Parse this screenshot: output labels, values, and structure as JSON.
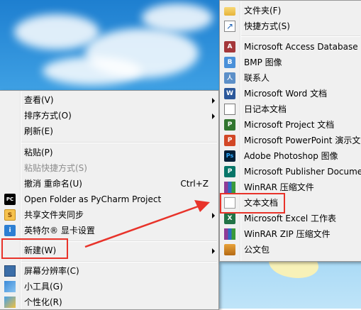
{
  "context_menu": {
    "items": [
      {
        "label": "查看(V)",
        "submenu": true
      },
      {
        "label": "排序方式(O)",
        "submenu": true
      },
      {
        "label": "刷新(E)"
      },
      {
        "label": "粘贴(P)"
      },
      {
        "label": "粘贴快捷方式(S)",
        "disabled": true
      },
      {
        "label": "撤消 重命名(U)",
        "shortcut": "Ctrl+Z"
      },
      {
        "label": "Open Folder as PyCharm Project",
        "icon": "pycharm-icon"
      },
      {
        "label": "共享文件夹同步",
        "icon": "shared-folder-icon",
        "submenu": true
      },
      {
        "label": "英特尔® 显卡设置",
        "icon": "intel-graphics-icon"
      },
      {
        "label": "新建(W)",
        "submenu": true,
        "highlighted": true
      },
      {
        "label": "屏幕分辨率(C)",
        "icon": "screen-resolution-icon"
      },
      {
        "label": "小工具(G)",
        "icon": "gadgets-icon"
      },
      {
        "label": "个性化(R)",
        "icon": "personalize-icon"
      }
    ]
  },
  "new_submenu": {
    "items": [
      {
        "label": "文件夹(F)",
        "icon": "folder-icon"
      },
      {
        "label": "快捷方式(S)",
        "icon": "shortcut-icon"
      },
      {
        "label": "Microsoft Access Database",
        "icon": "access-icon"
      },
      {
        "label": "BMP 图像",
        "icon": "bmp-icon"
      },
      {
        "label": "联系人",
        "icon": "contact-icon"
      },
      {
        "label": "Microsoft Word 文档",
        "icon": "word-icon"
      },
      {
        "label": "日记本文档",
        "icon": "journal-icon"
      },
      {
        "label": "Microsoft Project 文档",
        "icon": "project-icon"
      },
      {
        "label": "Microsoft PowerPoint 演示文",
        "icon": "powerpoint-icon"
      },
      {
        "label": "Adobe Photoshop 图像",
        "icon": "photoshop-icon"
      },
      {
        "label": "Microsoft Publisher Docume",
        "icon": "publisher-icon"
      },
      {
        "label": "WinRAR 压缩文件",
        "icon": "winrar-icon"
      },
      {
        "label": "文本文档",
        "icon": "text-document-icon",
        "highlighted": true
      },
      {
        "label": "Microsoft Excel 工作表",
        "icon": "excel-icon"
      },
      {
        "label": "WinRAR ZIP 压缩文件",
        "icon": "winrar-zip-icon"
      },
      {
        "label": "公文包",
        "icon": "briefcase-icon"
      }
    ]
  },
  "icon_glyphs": {
    "access": "A",
    "bmp": "B",
    "contact": "人",
    "word": "W",
    "project": "P",
    "powerpoint": "P",
    "photoshop": "Ps",
    "publisher": "P",
    "excel": "X",
    "pycharm": "PC",
    "shared": "S",
    "intel": "i"
  },
  "colors": {
    "highlight_box": "#e8332a",
    "arrow": "#e8332a",
    "menu_bg": "#f0f0f0"
  }
}
